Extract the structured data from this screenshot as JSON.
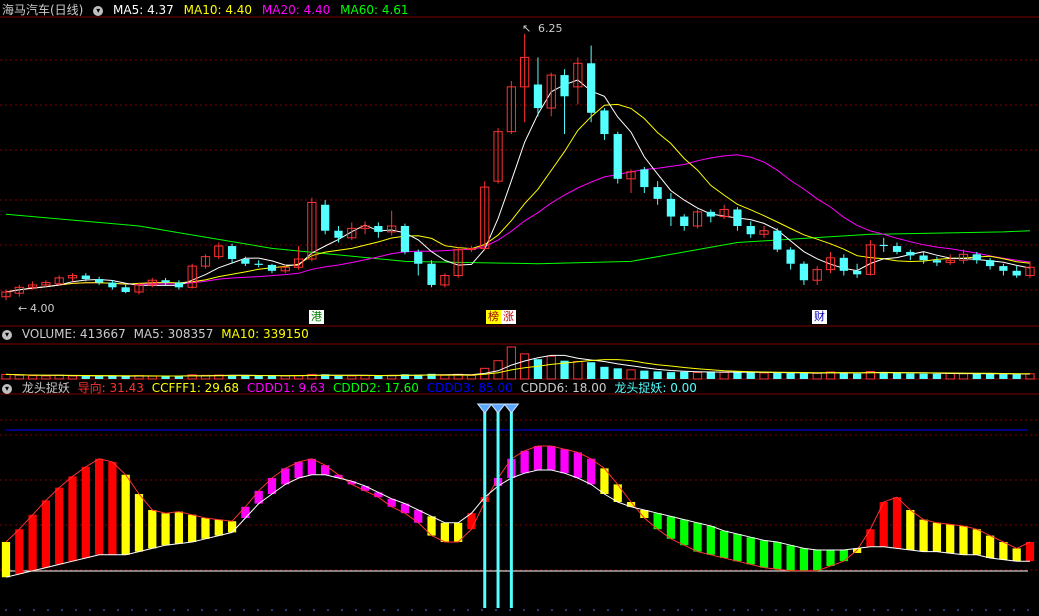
{
  "header": {
    "stock_name": "海马汽车(日线)",
    "ma5": "MA5: 4.37",
    "ma10": "MA10: 4.40",
    "ma20": "MA20: 4.40",
    "ma60": "MA60: 4.61"
  },
  "price_panel": {
    "high_label": "6.25",
    "low_label": "4.00",
    "markers": {
      "gang": "港",
      "bang": "榜",
      "zhang": "涨",
      "cai": "财"
    }
  },
  "volume_panel": {
    "volume": "VOLUME: 413667",
    "ma5": "MA5: 308357",
    "ma10": "MA10: 339150"
  },
  "indicator_panel": {
    "name": "龙头捉妖",
    "daoxiang": "导向: 31.43",
    "ccfff1": "CCFFF1: 29.68",
    "cdd1": "CDDD1: 9.63",
    "cdd2": "CDDD2: 17.60",
    "cdd3": "CDDD3: 85.00",
    "cdd6": "CDDD6: 18.00",
    "ltzy": "龙头捉妖: 0.00"
  },
  "colors": {
    "up": "#ff3232",
    "down": "#54ffff",
    "ma5": "#ffffff",
    "ma10": "#ffff00",
    "ma20": "#ff00ff",
    "ma60": "#00ff00",
    "grid": "#800000"
  },
  "chart_data": {
    "type": "candlestick",
    "candles": [
      [
        4.02,
        4.06,
        3.99,
        4.08
      ],
      [
        4.05,
        4.1,
        4.02,
        4.12
      ],
      [
        4.1,
        4.12,
        4.08,
        4.15
      ],
      [
        4.12,
        4.14,
        4.1,
        4.16
      ],
      [
        4.13,
        4.18,
        4.11,
        4.2
      ],
      [
        4.18,
        4.2,
        4.15,
        4.22
      ],
      [
        4.2,
        4.17,
        4.15,
        4.22
      ],
      [
        4.17,
        4.14,
        4.12,
        4.19
      ],
      [
        4.14,
        4.1,
        4.08,
        4.16
      ],
      [
        4.1,
        4.06,
        4.05,
        4.12
      ],
      [
        4.06,
        4.12,
        4.04,
        4.14
      ],
      [
        4.12,
        4.16,
        4.1,
        4.18
      ],
      [
        4.16,
        4.14,
        4.12,
        4.18
      ],
      [
        4.14,
        4.1,
        4.08,
        4.16
      ],
      [
        4.1,
        4.28,
        4.09,
        4.3
      ],
      [
        4.28,
        4.36,
        4.26,
        4.38
      ],
      [
        4.36,
        4.45,
        4.34,
        4.48
      ],
      [
        4.45,
        4.34,
        4.3,
        4.47
      ],
      [
        4.34,
        4.3,
        4.28,
        4.36
      ],
      [
        4.3,
        4.29,
        4.27,
        4.33
      ],
      [
        4.29,
        4.24,
        4.22,
        4.3
      ],
      [
        4.24,
        4.27,
        4.22,
        4.29
      ],
      [
        4.27,
        4.34,
        4.25,
        4.45
      ],
      [
        4.34,
        4.82,
        4.32,
        4.86
      ],
      [
        4.8,
        4.58,
        4.55,
        4.84
      ],
      [
        4.58,
        4.52,
        4.48,
        4.62
      ],
      [
        4.52,
        4.6,
        4.5,
        4.65
      ],
      [
        4.6,
        4.62,
        4.55,
        4.66
      ],
      [
        4.62,
        4.57,
        4.52,
        4.65
      ],
      [
        4.57,
        4.62,
        4.54,
        4.75
      ],
      [
        4.62,
        4.4,
        4.38,
        4.64
      ],
      [
        4.4,
        4.3,
        4.2,
        4.42
      ],
      [
        4.3,
        4.12,
        4.1,
        4.33
      ],
      [
        4.12,
        4.2,
        4.1,
        4.22
      ],
      [
        4.2,
        4.42,
        4.18,
        4.44
      ],
      [
        4.42,
        4.43,
        4.4,
        4.45
      ],
      [
        4.43,
        4.95,
        4.42,
        5.0
      ],
      [
        5.0,
        5.42,
        4.98,
        5.45
      ],
      [
        5.42,
        5.8,
        5.4,
        5.85
      ],
      [
        5.8,
        6.05,
        5.5,
        6.25
      ],
      [
        5.82,
        5.62,
        5.55,
        6.05
      ],
      [
        5.62,
        5.9,
        5.55,
        5.92
      ],
      [
        5.9,
        5.72,
        5.4,
        5.95
      ],
      [
        5.8,
        6.0,
        5.65,
        6.05
      ],
      [
        6.0,
        5.58,
        5.5,
        6.15
      ],
      [
        5.6,
        5.4,
        5.35,
        5.62
      ],
      [
        5.4,
        5.02,
        4.98,
        5.42
      ],
      [
        5.02,
        5.08,
        4.9,
        5.1
      ],
      [
        5.1,
        4.95,
        4.9,
        5.12
      ],
      [
        4.95,
        4.85,
        4.8,
        5.0
      ],
      [
        4.85,
        4.7,
        4.62,
        4.9
      ],
      [
        4.7,
        4.62,
        4.58,
        4.72
      ],
      [
        4.62,
        4.74,
        4.6,
        4.76
      ],
      [
        4.74,
        4.7,
        4.65,
        4.76
      ],
      [
        4.7,
        4.76,
        4.68,
        4.8
      ],
      [
        4.76,
        4.62,
        4.58,
        4.78
      ],
      [
        4.62,
        4.55,
        4.52,
        4.66
      ],
      [
        4.55,
        4.58,
        4.52,
        4.62
      ],
      [
        4.58,
        4.42,
        4.4,
        4.6
      ],
      [
        4.42,
        4.3,
        4.25,
        4.44
      ],
      [
        4.3,
        4.16,
        4.12,
        4.32
      ],
      [
        4.16,
        4.25,
        4.12,
        4.28
      ],
      [
        4.25,
        4.35,
        4.22,
        4.4
      ],
      [
        4.35,
        4.24,
        4.2,
        4.38
      ],
      [
        4.24,
        4.21,
        4.18,
        4.3
      ],
      [
        4.21,
        4.46,
        4.2,
        4.5
      ],
      [
        4.46,
        4.45,
        4.4,
        4.52
      ],
      [
        4.45,
        4.4,
        4.38,
        4.48
      ],
      [
        4.4,
        4.37,
        4.33,
        4.42
      ],
      [
        4.37,
        4.33,
        4.3,
        4.4
      ],
      [
        4.33,
        4.31,
        4.28,
        4.36
      ],
      [
        4.31,
        4.33,
        4.29,
        4.38
      ],
      [
        4.33,
        4.38,
        4.3,
        4.42
      ],
      [
        4.38,
        4.33,
        4.3,
        4.4
      ],
      [
        4.33,
        4.28,
        4.25,
        4.35
      ],
      [
        4.28,
        4.24,
        4.2,
        4.3
      ],
      [
        4.24,
        4.2,
        4.18,
        4.28
      ],
      [
        4.2,
        4.27,
        4.18,
        4.32
      ]
    ],
    "ma60_points": [
      [
        0,
        4.72
      ],
      [
        10,
        4.62
      ],
      [
        20,
        4.43
      ],
      [
        30,
        4.32
      ],
      [
        40,
        4.3
      ],
      [
        47,
        4.32
      ],
      [
        55,
        4.48
      ],
      [
        65,
        4.55
      ],
      [
        75,
        4.57
      ],
      [
        77,
        4.58
      ]
    ],
    "ylim": [
      3.95,
      6.35
    ],
    "volume": [
      60,
      50,
      45,
      40,
      48,
      40,
      38,
      35,
      42,
      36,
      44,
      38,
      36,
      40,
      55,
      48,
      52,
      50,
      42,
      40,
      44,
      40,
      46,
      60,
      62,
      42,
      40,
      44,
      40,
      48,
      62,
      55,
      68,
      50,
      62,
      48,
      140,
      240,
      420,
      330,
      260,
      300,
      240,
      230,
      220,
      160,
      140,
      120,
      110,
      100,
      90,
      95,
      85,
      92,
      88,
      90,
      86,
      80,
      82,
      78,
      74,
      76,
      92,
      84,
      70,
      98,
      86,
      80,
      72,
      70,
      68,
      74,
      70,
      72,
      66,
      64,
      60,
      68
    ],
    "indicator_upper": [
      30,
      38,
      47,
      56,
      64,
      71,
      77,
      82,
      80,
      72,
      60,
      50,
      48,
      49,
      47,
      45,
      44,
      43,
      52,
      62,
      70,
      76,
      80,
      82,
      78,
      72,
      66,
      62,
      58,
      52,
      48,
      42,
      34,
      30,
      30,
      38,
      55,
      70,
      82,
      87,
      90,
      90,
      88,
      86,
      82,
      76,
      66,
      55,
      45,
      38,
      32,
      28,
      24,
      22,
      20,
      18,
      16,
      14,
      13,
      12,
      12,
      12,
      15,
      18,
      25,
      38,
      55,
      58,
      50,
      44,
      42,
      41,
      40,
      38,
      34,
      30,
      26,
      30
    ],
    "indicator_lower": [
      8,
      10,
      12,
      14,
      16,
      18,
      20,
      22,
      22,
      22,
      24,
      26,
      28,
      29,
      30,
      32,
      34,
      36,
      45,
      54,
      60,
      66,
      70,
      72,
      72,
      70,
      68,
      65,
      61,
      57,
      54,
      50,
      46,
      42,
      42,
      48,
      58,
      65,
      70,
      73,
      75,
      75,
      73,
      70,
      66,
      60,
      55,
      52,
      50,
      48,
      46,
      44,
      42,
      40,
      37,
      35,
      33,
      31,
      30,
      28,
      26,
      25,
      25,
      25,
      26,
      27,
      27,
      26,
      25,
      24,
      24,
      23,
      22,
      22,
      20,
      19,
      18,
      18
    ],
    "indicator_colors": [
      "y",
      "r",
      "r",
      "r",
      "r",
      "r",
      "r",
      "r",
      "r",
      "y",
      "y",
      "y",
      "y",
      "y",
      "y",
      "y",
      "y",
      "y",
      "m",
      "m",
      "m",
      "m",
      "m",
      "m",
      "m",
      "m",
      "m",
      "m",
      "m",
      "m",
      "m",
      "m",
      "y",
      "y",
      "y",
      "r",
      "r",
      "m",
      "m",
      "m",
      "m",
      "m",
      "m",
      "m",
      "m",
      "y",
      "y",
      "y",
      "y",
      "g",
      "g",
      "g",
      "g",
      "g",
      "g",
      "g",
      "g",
      "g",
      "g",
      "g",
      "g",
      "g",
      "g",
      "g",
      "y",
      "r",
      "r",
      "r",
      "y",
      "y",
      "y",
      "y",
      "y",
      "y",
      "y",
      "y",
      "y",
      "r"
    ],
    "signal_bars": [
      36,
      37,
      38
    ]
  }
}
